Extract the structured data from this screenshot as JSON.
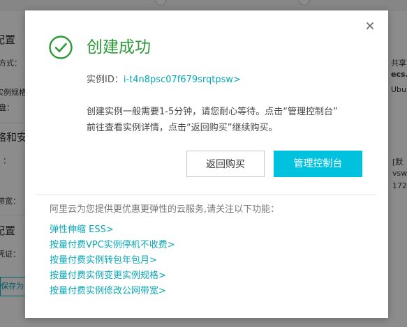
{
  "background": {
    "left_texts": [
      "配置",
      "方式：",
      "实例规格",
      "盘：",
      "络和安",
      "：",
      "带宽：",
      "配置",
      "凭证："
    ],
    "right_texts": [
      "共享",
      "ecs.x",
      "Ubun",
      "[默",
      "vsw",
      "172"
    ],
    "save_button_label": "保存为"
  },
  "dialog": {
    "title": "创建成功",
    "instance_label": "实例ID：",
    "instance_id": "i-t4n8psc07f679srqtpsw>",
    "desc_line1": "创建实例一般需要1-5分钟，请您耐心等待。点击“管理控制台”",
    "desc_line2": "前往查看实例详情，点击“返回购买”继续购买。",
    "back_button": "返回购买",
    "console_button": "管理控制台",
    "promo_heading": "阿里云为您提供更优惠更弹性的云服务,请关注以下功能：",
    "promo_links": [
      "弹性伸缩 ESS>",
      "按量付费VPC实例停机不收费>",
      "按量付费实例转包年包月>",
      "按量付费实例变更实例规格>",
      "按量付费实例修改公网带宽>"
    ]
  },
  "colors": {
    "accent": "#00c1de",
    "link": "#0aa6b5",
    "success": "#2b9939"
  }
}
